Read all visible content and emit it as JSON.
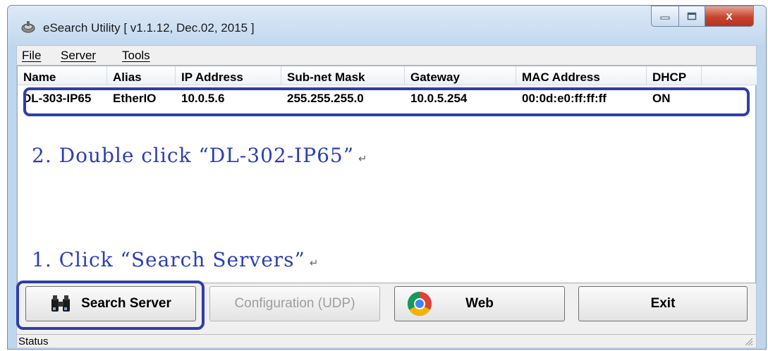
{
  "window": {
    "title": "eSearch Utility [ v1.1.12, Dec.02, 2015 ]"
  },
  "controls": {
    "close": "x"
  },
  "menu": {
    "items": [
      "File",
      "Server",
      "Tools"
    ]
  },
  "list": {
    "columns": [
      "Name",
      "Alias",
      "IP Address",
      "Sub-net Mask",
      "Gateway",
      "MAC Address",
      "DHCP"
    ],
    "rows": [
      [
        "DL-303-IP65",
        "EtherIO",
        "10.0.5.6",
        "255.255.255.0",
        "10.0.5.254",
        "00:0d:e0:ff:ff:ff",
        "ON"
      ]
    ]
  },
  "annotations": {
    "step2": "2. Double click “DL-302-IP65”",
    "step1": "1. Click “Search Servers”",
    "return_mark": "↵"
  },
  "buttons": {
    "search": "Search Server",
    "config": "Configuration (UDP)",
    "web": "Web",
    "exit": "Exit"
  },
  "status": {
    "text": "Status"
  },
  "colors": {
    "annotation": "#2b3fb3",
    "highlight_box": "#2f3fa8"
  }
}
